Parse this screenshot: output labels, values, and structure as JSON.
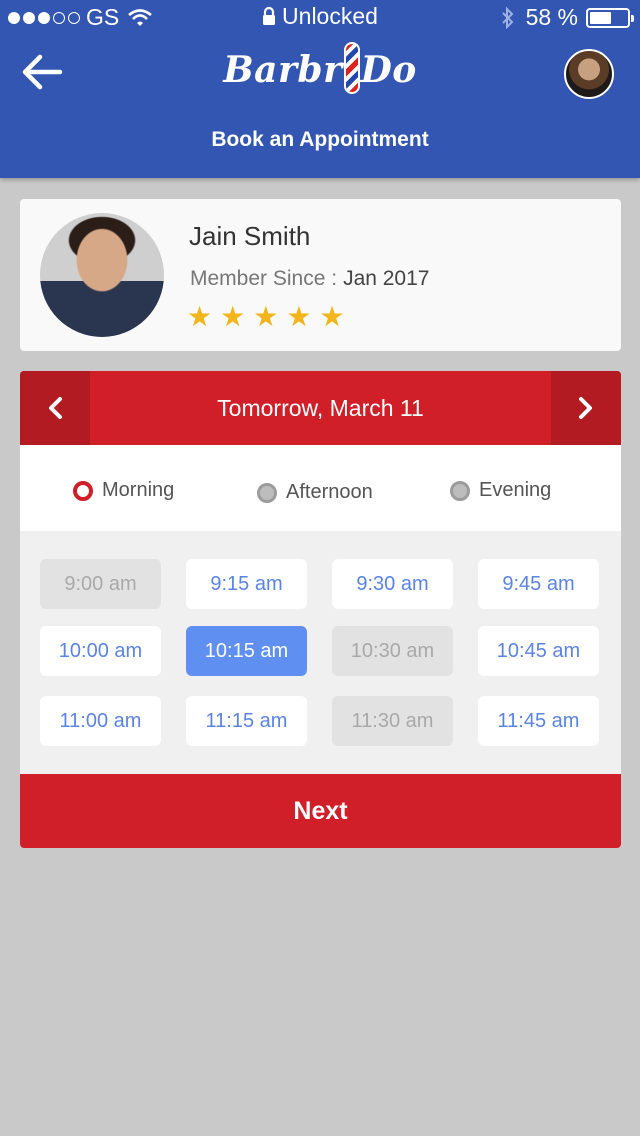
{
  "status_bar": {
    "carrier": "GS",
    "lock_status": "Unlocked",
    "battery": "58 %",
    "battery_level": 0.58
  },
  "header": {
    "logo_text_left": "Barbr",
    "logo_text_right": "Do",
    "title": "Book an Appointment"
  },
  "profile": {
    "name": "Jain Smith",
    "member_label": "Member Since :",
    "member_value": "Jan 2017",
    "rating": 5
  },
  "date_nav": {
    "label": "Tomorrow, March 11"
  },
  "periods": [
    {
      "label": "Morning",
      "selected": true
    },
    {
      "label": "Afternoon",
      "selected": false
    },
    {
      "label": "Evening",
      "selected": false
    }
  ],
  "slots": [
    {
      "time": "9:00 am",
      "state": "disabled"
    },
    {
      "time": "9:15 am",
      "state": "available"
    },
    {
      "time": "9:30 am",
      "state": "available"
    },
    {
      "time": "9:45 am",
      "state": "available"
    },
    {
      "time": "10:00 am",
      "state": "available"
    },
    {
      "time": "10:15 am",
      "state": "selected"
    },
    {
      "time": "10:30 am",
      "state": "disabled"
    },
    {
      "time": "10:45 am",
      "state": "available"
    },
    {
      "time": "11:00 am",
      "state": "available"
    },
    {
      "time": "11:15 am",
      "state": "available"
    },
    {
      "time": "11:30 am",
      "state": "disabled"
    },
    {
      "time": "11:45 am",
      "state": "available"
    }
  ],
  "next_label": "Next",
  "colors": {
    "header_blue": "#3256b2",
    "accent_red": "#d01f28",
    "slot_blue": "#5e8ff1",
    "star_gold": "#f2b51c"
  }
}
